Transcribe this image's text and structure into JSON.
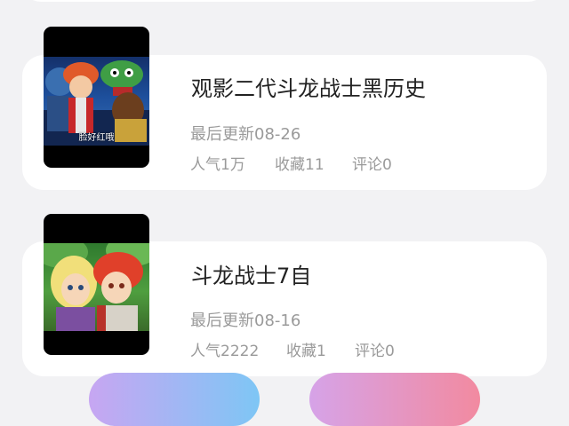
{
  "items": [
    {
      "title": "观影二代斗龙战士黑历史",
      "updated": "最后更新08-26",
      "popularity": "人气1万",
      "favorites": "收藏11",
      "comments": "评论0",
      "cover_caption": "脸好红哦"
    },
    {
      "title": "斗龙战士7自",
      "updated": "最后更新08-16",
      "popularity": "人气2222",
      "favorites": "收藏1",
      "comments": "评论0",
      "cover_caption": ""
    }
  ],
  "buttons": {
    "left_label": "",
    "right_label": ""
  }
}
